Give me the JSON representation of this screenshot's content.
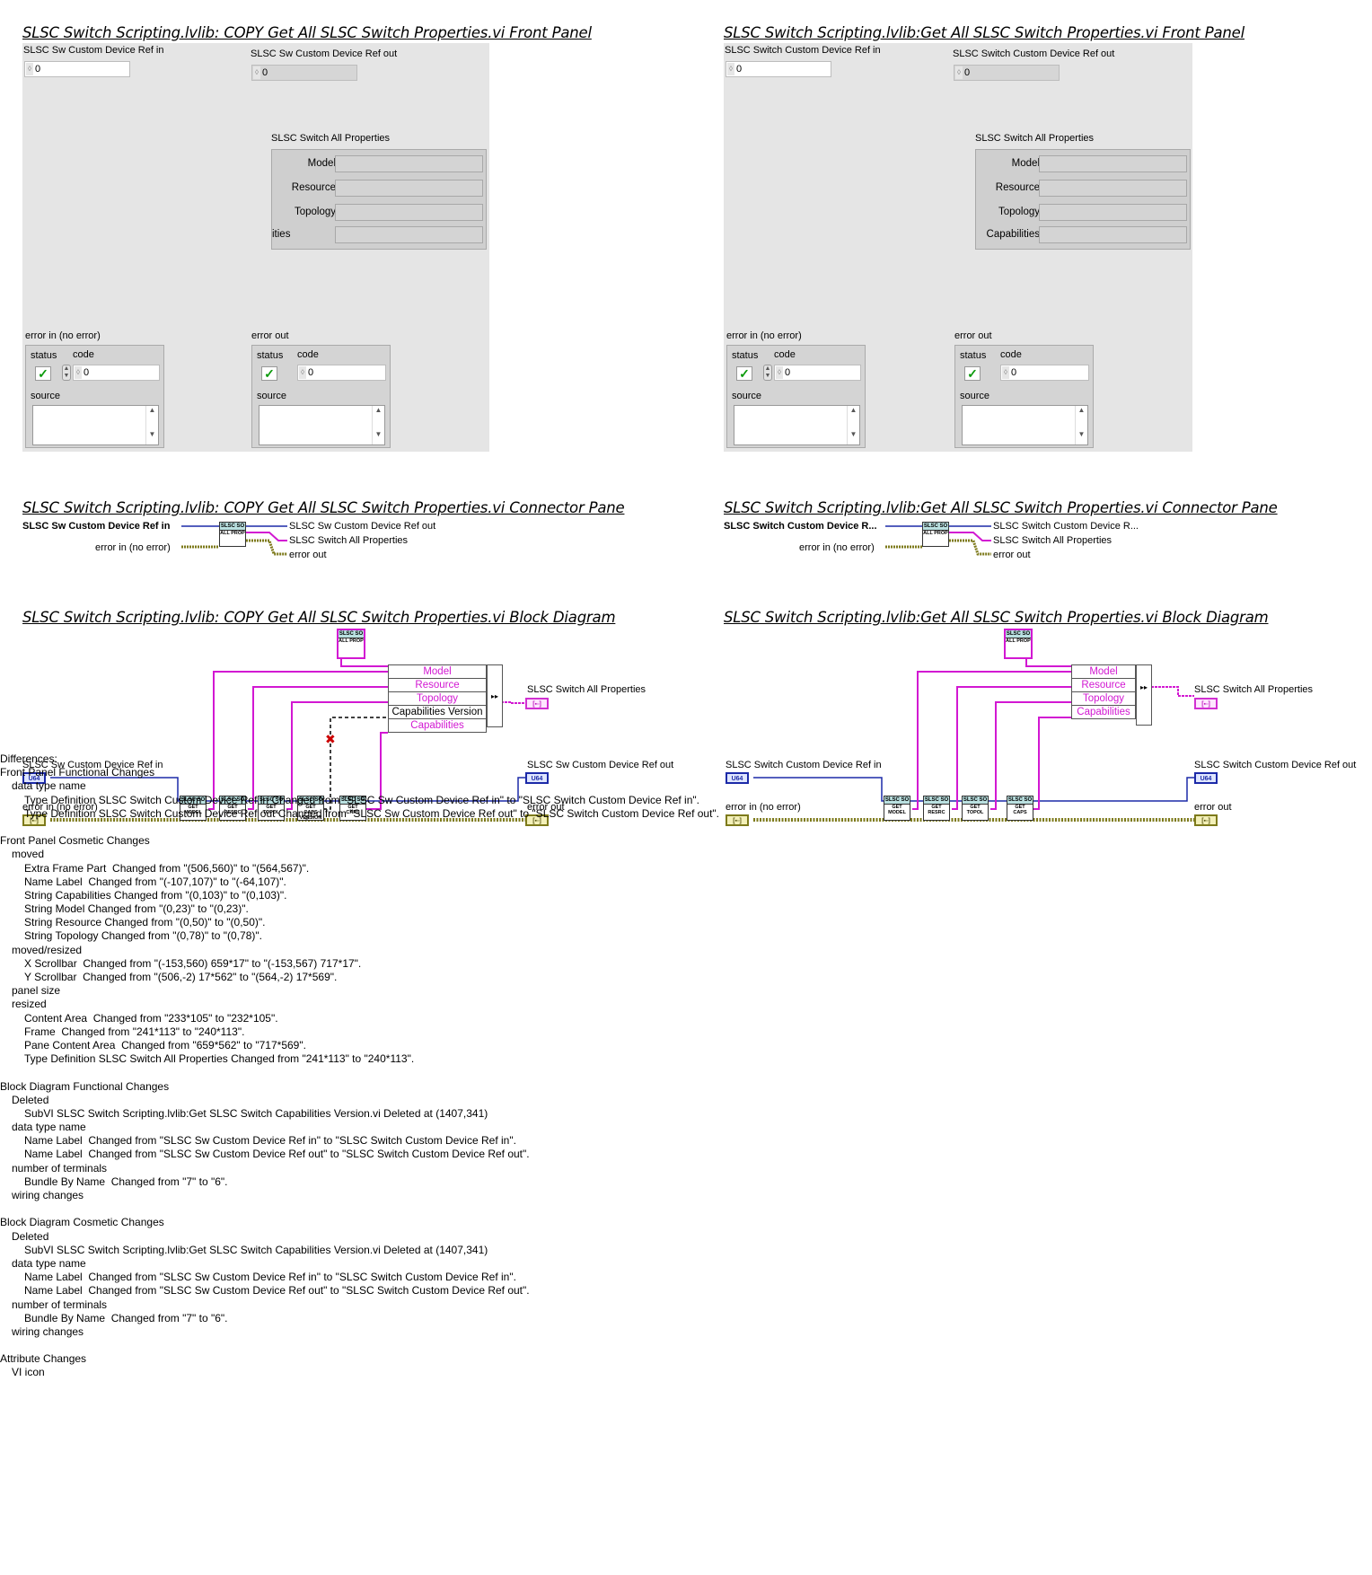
{
  "left": {
    "fp_title": "SLSC Switch Scripting.lvlib:  COPY  Get All SLSC Switch Properties.vi Front Panel",
    "cp_title": "SLSC Switch Scripting.lvlib:  COPY  Get All SLSC Switch Properties.vi Connector Pane",
    "bd_title": "SLSC Switch Scripting.lvlib:  COPY  Get All SLSC Switch Properties.vi Block Diagram",
    "ref_in_label": "SLSC Sw Custom Device Ref in",
    "ref_out_label": "SLSC Sw Custom Device Ref out",
    "ref_in_value": "0",
    "ref_out_value": "0",
    "all_props_label": "SLSC Switch All Properties",
    "props": [
      "Model",
      "Resource",
      "Topology",
      "ities"
    ],
    "error_in_label": "error in (no error)",
    "error_out_label": "error out",
    "cp_ref_in": "SLSC Sw Custom Device Ref in",
    "cp_error_in": "error in (no error)",
    "cp_ref_out": "SLSC Sw Custom Device Ref out",
    "cp_all_props": "SLSC Switch All Properties",
    "cp_error_out": "error out",
    "bd_ref_in": "SLSC Sw Custom Device Ref in",
    "bd_error_in": "error in (no error)",
    "bd_all_props": "SLSC Switch All Properties",
    "bd_ref_out": "SLSC Sw Custom Device Ref out",
    "bd_error_out": "error out",
    "bundle_rows": [
      "Model",
      "Resource",
      "Topology",
      "Capabilities Version",
      "Capabilities"
    ],
    "subvis": [
      "GET MODEL",
      "GET RESRC",
      "GET TOPOL",
      "GET CAPS VERSION",
      "GET CAPS"
    ]
  },
  "right": {
    "fp_title": "SLSC Switch Scripting.lvlib:Get All SLSC Switch Properties.vi Front Panel",
    "cp_title": "SLSC Switch Scripting.lvlib:Get All SLSC Switch Properties.vi Connector Pane",
    "bd_title": "SLSC Switch Scripting.lvlib:Get All SLSC Switch Properties.vi Block Diagram",
    "ref_in_label": "SLSC Switch Custom Device Ref in",
    "ref_out_label": "SLSC Switch Custom Device Ref out",
    "ref_in_value": "0",
    "ref_out_value": "0",
    "all_props_label": "SLSC Switch All Properties",
    "props": [
      "Model",
      "Resource",
      "Topology",
      "Capabilities"
    ],
    "error_in_label": "error in (no error)",
    "error_out_label": "error out",
    "cp_ref_in": "SLSC Switch Custom Device R...",
    "cp_error_in": "error in (no error)",
    "cp_ref_out": "SLSC Switch Custom Device R...",
    "cp_all_props": "SLSC Switch All Properties",
    "cp_error_out": "error out",
    "bd_ref_in": "SLSC Switch Custom Device Ref in",
    "bd_error_in": "error in (no error)",
    "bd_all_props": "SLSC Switch All Properties",
    "bd_ref_out": "SLSC Switch Custom Device Ref out",
    "bd_error_out": "error out",
    "bundle_rows": [
      "Model",
      "Resource",
      "Topology",
      "Capabilities"
    ],
    "subvis": [
      "GET MODEL",
      "GET RESRC",
      "GET TOPOL",
      "GET CAPS"
    ]
  },
  "common": {
    "status_label": "status",
    "code_label": "code",
    "source_label": "source",
    "code_value": "0",
    "subvi_header": "SLSC SO",
    "all_prop_icon": "ALL PROP",
    "u64_tag": "U64",
    "err_tag": "[▪▫]",
    "cluster_tag": "[▪▫]"
  },
  "differences": [
    {
      "level": 1,
      "text": "Differences:"
    },
    {
      "level": 1,
      "text": "Front Panel Functional Changes"
    },
    {
      "level": 2,
      "text": "data type name"
    },
    {
      "level": 3,
      "text": "Type Definition SLSC Switch Custom Device Ref in Changed from \"SLSC Sw Custom Device Ref in\" to \"SLSC Switch Custom Device Ref in\"."
    },
    {
      "level": 3,
      "text": "Type Definition SLSC Switch Custom Device Ref out Changed from \"SLSC Sw Custom Device Ref out\" to \"SLSC Switch Custom Device Ref out\"."
    },
    {
      "level": 1,
      "text": ""
    },
    {
      "level": 1,
      "text": "Front Panel Cosmetic Changes"
    },
    {
      "level": 2,
      "text": "moved"
    },
    {
      "level": 3,
      "text": "Extra Frame Part  Changed from \"(506,560)\" to \"(564,567)\"."
    },
    {
      "level": 3,
      "text": "Name Label  Changed from \"(-107,107)\" to \"(-64,107)\"."
    },
    {
      "level": 3,
      "text": "String Capabilities Changed from \"(0,103)\" to \"(0,103)\"."
    },
    {
      "level": 3,
      "text": "String Model Changed from \"(0,23)\" to \"(0,23)\"."
    },
    {
      "level": 3,
      "text": "String Resource Changed from \"(0,50)\" to \"(0,50)\"."
    },
    {
      "level": 3,
      "text": "String Topology Changed from \"(0,78)\" to \"(0,78)\"."
    },
    {
      "level": 2,
      "text": "moved/resized"
    },
    {
      "level": 3,
      "text": "X Scrollbar  Changed from \"(-153,560) 659*17\" to \"(-153,567) 717*17\"."
    },
    {
      "level": 3,
      "text": "Y Scrollbar  Changed from \"(506,-2) 17*562\" to \"(564,-2) 17*569\"."
    },
    {
      "level": 2,
      "text": "panel size"
    },
    {
      "level": 2,
      "text": "resized"
    },
    {
      "level": 3,
      "text": "Content Area  Changed from \"233*105\" to \"232*105\"."
    },
    {
      "level": 3,
      "text": "Frame  Changed from \"241*113\" to \"240*113\"."
    },
    {
      "level": 3,
      "text": "Pane Content Area  Changed from \"659*562\" to \"717*569\"."
    },
    {
      "level": 3,
      "text": "Type Definition SLSC Switch All Properties Changed from \"241*113\" to \"240*113\"."
    },
    {
      "level": 1,
      "text": ""
    },
    {
      "level": 1,
      "text": "Block Diagram Functional Changes"
    },
    {
      "level": 2,
      "text": "Deleted"
    },
    {
      "level": 3,
      "text": "SubVI SLSC Switch Scripting.lvlib:Get SLSC Switch Capabilities Version.vi Deleted at (1407,341)"
    },
    {
      "level": 2,
      "text": "data type name"
    },
    {
      "level": 3,
      "text": "Name Label  Changed from \"SLSC Sw Custom Device Ref in\" to \"SLSC Switch Custom Device Ref in\"."
    },
    {
      "level": 3,
      "text": "Name Label  Changed from \"SLSC Sw Custom Device Ref out\" to \"SLSC Switch Custom Device Ref out\"."
    },
    {
      "level": 2,
      "text": "number of terminals"
    },
    {
      "level": 3,
      "text": "Bundle By Name  Changed from \"7\" to \"6\"."
    },
    {
      "level": 2,
      "text": "wiring changes"
    },
    {
      "level": 1,
      "text": ""
    },
    {
      "level": 1,
      "text": "Block Diagram Cosmetic Changes"
    },
    {
      "level": 2,
      "text": "Deleted"
    },
    {
      "level": 3,
      "text": "SubVI SLSC Switch Scripting.lvlib:Get SLSC Switch Capabilities Version.vi Deleted at (1407,341)"
    },
    {
      "level": 2,
      "text": "data type name"
    },
    {
      "level": 3,
      "text": "Name Label  Changed from \"SLSC Sw Custom Device Ref in\" to \"SLSC Switch Custom Device Ref in\"."
    },
    {
      "level": 3,
      "text": "Name Label  Changed from \"SLSC Sw Custom Device Ref out\" to \"SLSC Switch Custom Device Ref out\"."
    },
    {
      "level": 2,
      "text": "number of terminals"
    },
    {
      "level": 3,
      "text": "Bundle By Name  Changed from \"7\" to \"6\"."
    },
    {
      "level": 2,
      "text": "wiring changes"
    },
    {
      "level": 1,
      "text": ""
    },
    {
      "level": 1,
      "text": "Attribute Changes"
    },
    {
      "level": 2,
      "text": "VI icon"
    }
  ],
  "colors": {
    "panel": "#e5e5e5",
    "wire_u64": "#1c2aa8",
    "wire_cluster": "#d218d2",
    "wire_error": "#7d7a1b"
  }
}
